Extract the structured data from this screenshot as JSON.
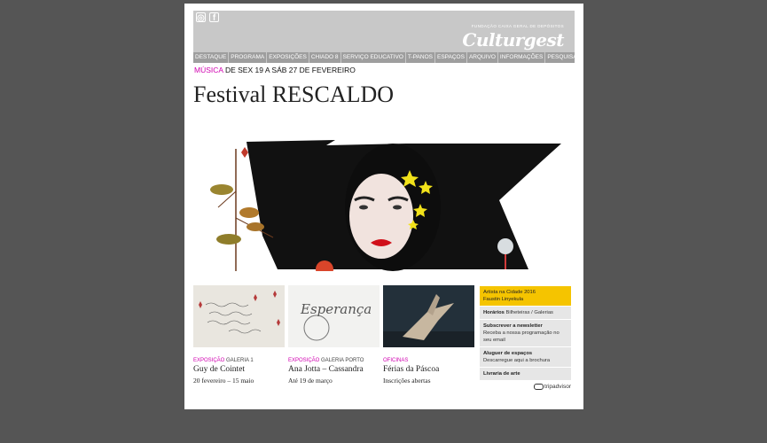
{
  "header": {
    "tagline": "FUNDAÇÃO CAIXA GERAL DE DEPÓSITOS",
    "logo": "Culturgest",
    "social": [
      {
        "icon": "instagram-icon",
        "glyph": "◎"
      },
      {
        "icon": "facebook-icon",
        "glyph": "f"
      }
    ]
  },
  "nav": [
    "DESTAQUE",
    "PROGRAMA",
    "EXPOSIÇÕES",
    "CHIADO 8",
    "SERVIÇO EDUCATIVO",
    "T-PANOS",
    "ESPAÇOS",
    "ARQUIVO",
    "INFORMAÇÕES",
    "PESQUISAR"
  ],
  "event": {
    "category": "MÚSICA",
    "dates": " DE SEX 19 A SÁB 27 DE FEVEREIRO",
    "title": "Festival RESCALDO"
  },
  "cards": [
    {
      "category": "EXPOSIÇÃO",
      "venue": " GALERIA 1",
      "title": "Guy de Cointet",
      "subtitle": "20 fevereiro – 15 maio"
    },
    {
      "category": "EXPOSIÇÃO",
      "venue": " GALERIA PORTO",
      "title": "Ana Jotta – Cassandra",
      "subtitle": "Até 19 de março",
      "thumb_text": "Esperança"
    },
    {
      "category": "OFICINAS",
      "venue": "",
      "title": "Férias da Páscoa",
      "subtitle": "Inscrições abertas"
    }
  ],
  "sidebar": [
    {
      "title": "Artista na Cidade 2016",
      "text": "Faustin Linyekula",
      "highlight": true
    },
    {
      "title": "Horários",
      "text": " Bilheteiras / Galerias"
    },
    {
      "title": "Subscrever a newsletter",
      "text": "Receba a nossa programação no seu email"
    },
    {
      "title": "Aluguer de espaços",
      "text": "Descarregue aqui a brochura"
    },
    {
      "title": "Livraria de arte",
      "text": ""
    }
  ],
  "tripadvisor": "tripadvisor"
}
